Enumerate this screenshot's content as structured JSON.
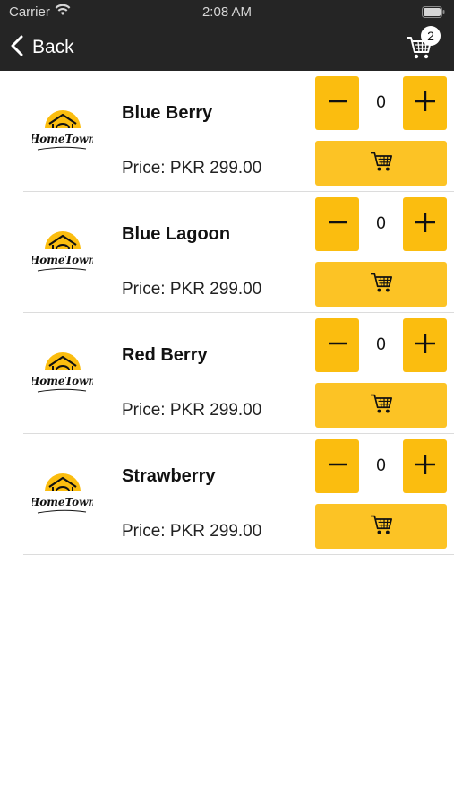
{
  "status_bar": {
    "carrier": "Carrier",
    "time": "2:08 AM",
    "wifi_icon": "wifi-icon",
    "battery_icon": "battery-icon"
  },
  "nav": {
    "back_label": "Back",
    "back_icon": "chevron-left-icon",
    "cart_icon": "shopping-cart-icon",
    "cart_count": "2"
  },
  "colors": {
    "nav_background": "#252525",
    "button_yellow": "#fbbd0f",
    "cart_button_yellow": "#fcc325",
    "logo_sun": "#fbbd0f"
  },
  "products": [
    {
      "name": "Blue Berry",
      "price": "Price: PKR 299.00",
      "quantity": "0"
    },
    {
      "name": "Blue Lagoon",
      "price": "Price: PKR 299.00",
      "quantity": "0"
    },
    {
      "name": "Red Berry",
      "price": "Price: PKR 299.00",
      "quantity": "0"
    },
    {
      "name": "Strawberry",
      "price": "Price: PKR 299.00",
      "quantity": "0"
    }
  ],
  "product_logo": {
    "text": "HomeTown",
    "icon": "hometown-logo-icon"
  },
  "row_icons": {
    "minus": "minus-icon",
    "plus": "plus-icon",
    "add_to_cart": "add-to-cart-icon"
  }
}
